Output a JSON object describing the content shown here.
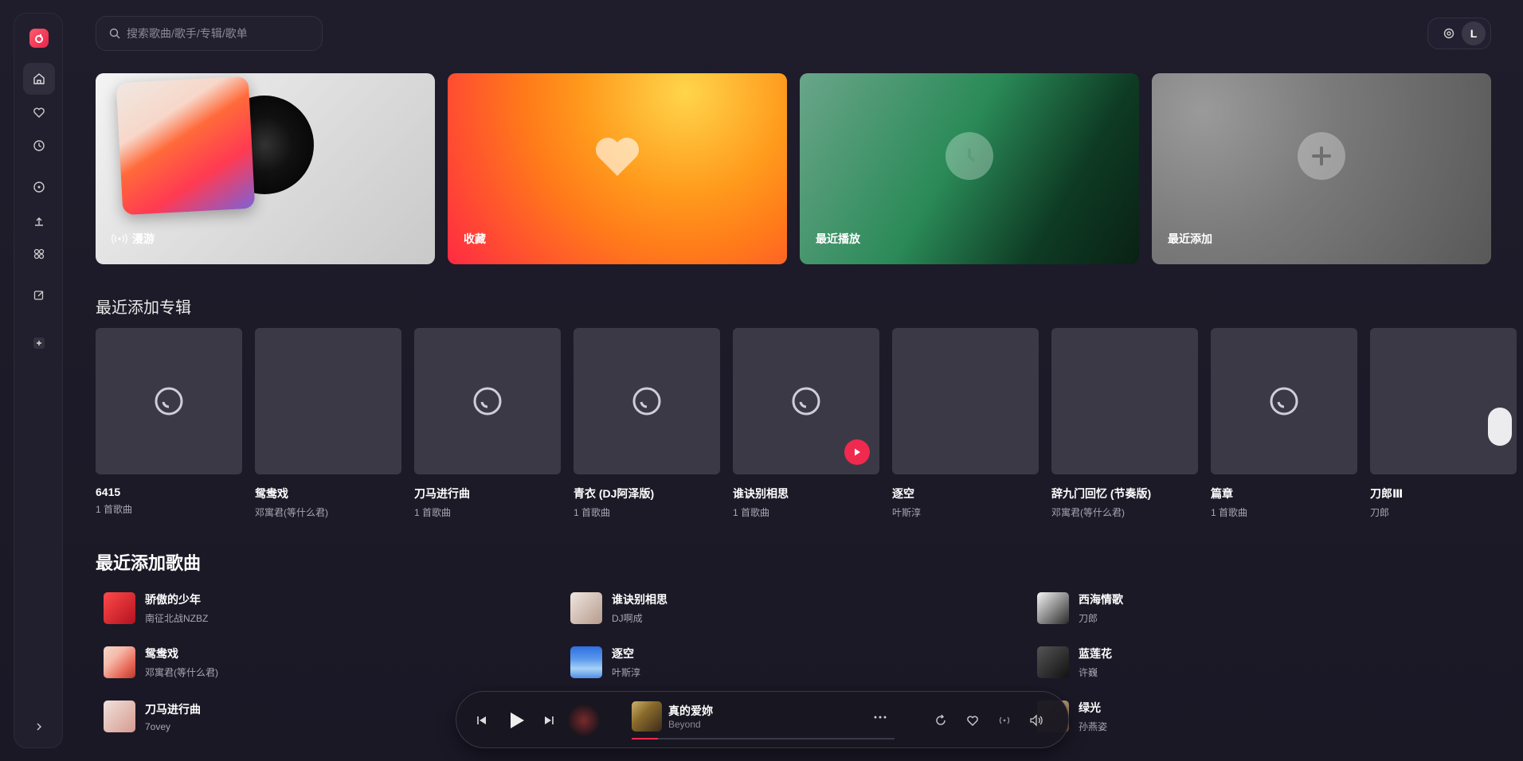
{
  "app": {
    "accent": "#f0294e"
  },
  "sidebar": {
    "items": [
      {
        "name": "home",
        "icon": "home-icon",
        "active": true
      },
      {
        "name": "favorites",
        "icon": "heart-icon"
      },
      {
        "name": "recent",
        "icon": "clock-icon"
      },
      {
        "name": "explore",
        "icon": "compass-icon"
      },
      {
        "name": "cloud",
        "icon": "cloud-upload-icon"
      },
      {
        "name": "library",
        "icon": "grid-icon"
      },
      {
        "name": "edit",
        "icon": "edit-icon"
      },
      {
        "name": "add",
        "icon": "plus-icon"
      }
    ],
    "collapse_icon": "chevron-right-icon"
  },
  "search": {
    "placeholder": "搜索歌曲/歌手/专辑/歌单"
  },
  "user": {
    "initial": "L"
  },
  "hero": {
    "roam": "漫游",
    "favorites": "收藏",
    "recent_play": "最近播放",
    "recent_add": "最近添加"
  },
  "albums_section": {
    "title": "最近添加专辑"
  },
  "albums": [
    {
      "name": "6415",
      "sub": "1 首歌曲"
    },
    {
      "name": "鸳鸯戏",
      "sub": "邓寓君(等什么君)"
    },
    {
      "name": "刀马进行曲",
      "sub": "1 首歌曲"
    },
    {
      "name": "青衣 (DJ阿泽版)",
      "sub": "1 首歌曲"
    },
    {
      "name": "谁诀别相思",
      "sub": "1 首歌曲"
    },
    {
      "name": "逐空",
      "sub": "叶斯淳"
    },
    {
      "name": "辞九门回忆 (节奏版)",
      "sub": "邓寓君(等什么君)"
    },
    {
      "name": "篇章",
      "sub": "1 首歌曲"
    },
    {
      "name": "刀郎Ⅲ",
      "sub": "刀郎"
    }
  ],
  "songs_section": {
    "title": "最近添加歌曲"
  },
  "songs": [
    {
      "title": "骄傲的少年",
      "artist": "南征北战NZBZ"
    },
    {
      "title": "谁诀别相思",
      "artist": "DJ啊成"
    },
    {
      "title": "西海情歌",
      "artist": "刀郎"
    },
    {
      "title": "鸳鸯戏",
      "artist": "邓寓君(等什么君)"
    },
    {
      "title": "逐空",
      "artist": "叶斯淳"
    },
    {
      "title": "蓝莲花",
      "artist": "许巍"
    },
    {
      "title": "刀马进行曲",
      "artist": "7ovey"
    },
    {
      "title": "绿光",
      "artist": "孙燕姿"
    }
  ],
  "player": {
    "title": "真的爱妳",
    "artist": "Beyond",
    "progress": 0.1
  }
}
